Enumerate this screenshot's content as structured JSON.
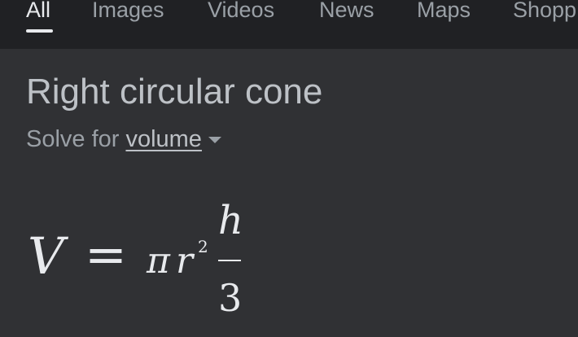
{
  "tabs": [
    {
      "label": "All",
      "active": true
    },
    {
      "label": "Images",
      "active": false
    },
    {
      "label": "Videos",
      "active": false
    },
    {
      "label": "News",
      "active": false
    },
    {
      "label": "Maps",
      "active": false
    },
    {
      "label": "Shopp",
      "active": false
    }
  ],
  "card": {
    "title": "Right circular cone",
    "solve_prefix": "Solve for",
    "solve_value": "volume"
  },
  "formula": {
    "lhs": "V",
    "equals": "=",
    "pi": "π",
    "r": "r",
    "exponent": "2",
    "numerator": "h",
    "denominator": "3"
  },
  "colors": {
    "background": "#303134",
    "tab_bar": "#202124",
    "active_text": "#e8eaed",
    "muted_text": "#9aa0a6"
  }
}
